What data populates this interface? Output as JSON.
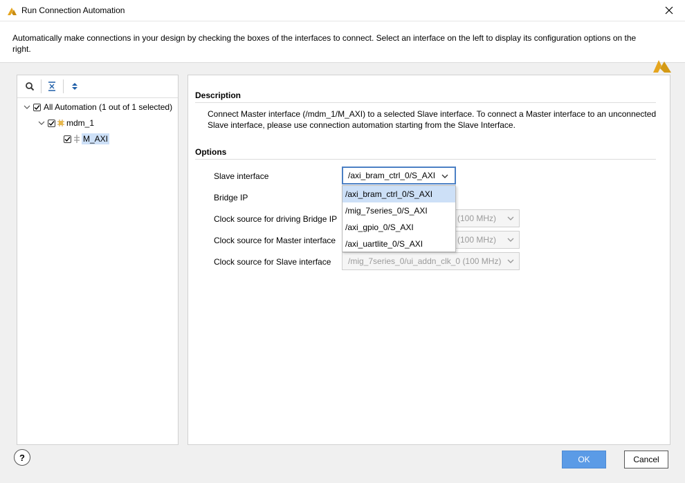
{
  "window": {
    "title": "Run Connection Automation",
    "logo_icon": "vivado-logo-icon",
    "close_icon": "close-icon"
  },
  "banner": {
    "text": "Automatically make connections in your design by checking the boxes of the interfaces to connect. Select an interface on the left to display its configuration options on the right."
  },
  "tree": {
    "toolbar": [
      "search-icon",
      "collapse-all-icon",
      "expand-all-icon"
    ],
    "items": [
      {
        "label": "All Automation (1 out of 1 selected)",
        "checked": true,
        "expanded": true
      },
      {
        "label": "mdm_1",
        "checked": true,
        "expanded": true,
        "icon": "ip-core-icon"
      },
      {
        "label": "M_AXI",
        "checked": true,
        "selected": true,
        "icon": "axi-interface-icon"
      }
    ]
  },
  "details": {
    "description_heading": "Description",
    "description_text": "Connect Master interface (/mdm_1/M_AXI) to a selected Slave interface. To connect a Master interface to an unconnected Slave interface, please use connection automation starting from the Slave Interface.",
    "options_heading": "Options",
    "options": [
      {
        "label": "Slave interface",
        "value": "/axi_bram_ctrl_0/S_AXI"
      },
      {
        "label": "Bridge IP",
        "value": ""
      },
      {
        "label": "Clock source for driving Bridge IP",
        "value": "(100 MHz)"
      },
      {
        "label": "Clock source for Master interface",
        "value": "(100 MHz)"
      },
      {
        "label": "Clock source for Slave interface",
        "value": "/mig_7series_0/ui_addn_clk_0 (100 MHz)"
      }
    ],
    "dropdown_items": [
      "/axi_bram_ctrl_0/S_AXI",
      "/mig_7series_0/S_AXI",
      "/axi_gpio_0/S_AXI",
      "/axi_uartlite_0/S_AXI"
    ]
  },
  "footer": {
    "help_label": "?",
    "ok_label": "OK",
    "cancel_label": "Cancel"
  },
  "colors": {
    "accent": "#5b9be6",
    "selection": "#cde0f7",
    "logo": "#e5a51e"
  }
}
